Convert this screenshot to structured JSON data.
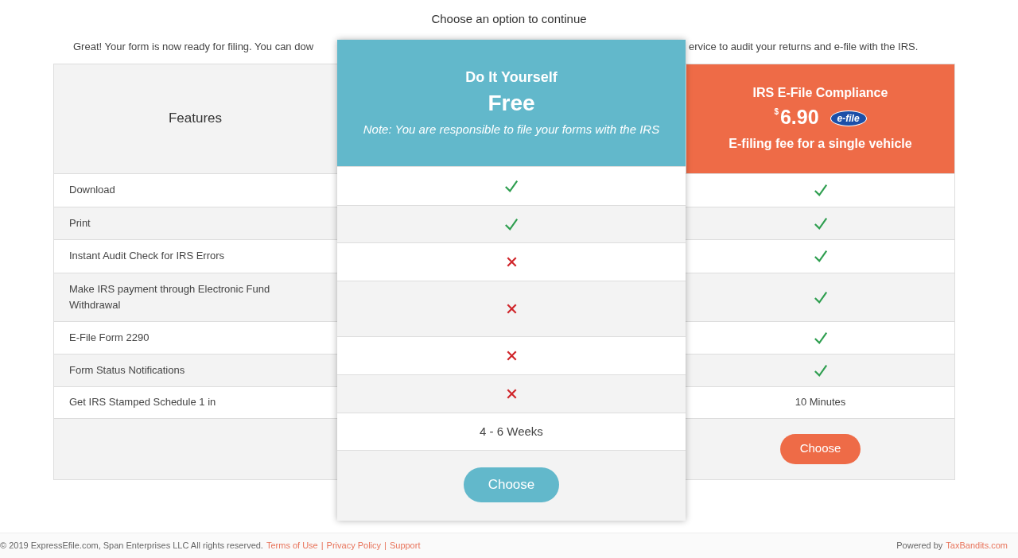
{
  "heading": "Choose an option to continue",
  "intro_left": "Great! Your form is now ready for filing. You can dow",
  "intro_right": "ervice to audit your returns and e-file with the IRS.",
  "features_heading": "Features",
  "plans": [
    {
      "kind": "diy",
      "title": "Do It Yourself",
      "price": "Free",
      "note": "Note: You are responsible to file your forms with the IRS",
      "button": "Choose"
    },
    {
      "kind": "efile",
      "title": "IRS E-File Compliance",
      "currency": "$",
      "price": "6.90",
      "badge": "e-file",
      "subtitle": "E-filing fee for a single vehicle",
      "button": "Choose"
    }
  ],
  "rows": [
    {
      "label": "Download",
      "cells": [
        {
          "kind": "check"
        },
        {
          "kind": "check"
        }
      ]
    },
    {
      "label": "Print",
      "cells": [
        {
          "kind": "check"
        },
        {
          "kind": "check"
        }
      ]
    },
    {
      "label": "Instant Audit Check for IRS Errors",
      "cells": [
        {
          "kind": "cross"
        },
        {
          "kind": "check"
        }
      ]
    },
    {
      "label": "Make IRS payment through Electronic Fund Withdrawal",
      "cells": [
        {
          "kind": "cross"
        },
        {
          "kind": "check"
        }
      ]
    },
    {
      "label": "E-File Form 2290",
      "cells": [
        {
          "kind": "cross"
        },
        {
          "kind": "check"
        }
      ]
    },
    {
      "label": "Form Status Notifications",
      "cells": [
        {
          "kind": "cross"
        },
        {
          "kind": "check"
        }
      ]
    },
    {
      "label": "Get IRS Stamped Schedule 1 in",
      "cells": [
        {
          "kind": "text",
          "text": "4 - 6 Weeks"
        },
        {
          "kind": "text",
          "text": "10 Minutes"
        }
      ]
    }
  ],
  "footer": {
    "copyright": "© 2019 ExpressEfile.com, Span Enterprises LLC All rights reserved.",
    "links": [
      "Terms of Use",
      "Privacy Policy",
      "Support"
    ],
    "separators": [
      "|",
      "|"
    ],
    "powered_by": "Powered by",
    "powered_link": "TaxBandits.com"
  }
}
